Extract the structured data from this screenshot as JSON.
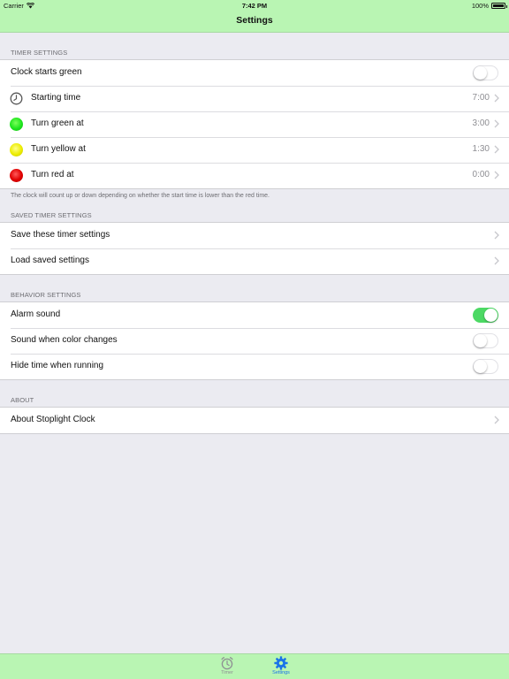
{
  "status_bar": {
    "carrier": "Carrier",
    "time": "7:42 PM",
    "battery": "100%"
  },
  "nav": {
    "title": "Settings"
  },
  "timer_settings": {
    "header": "TIMER SETTINGS",
    "clock_starts_green": {
      "label": "Clock starts green",
      "on": false
    },
    "starting_time": {
      "label": "Starting time",
      "value": "7:00",
      "icon": "clock-icon"
    },
    "turn_green": {
      "label": "Turn green at",
      "value": "3:00",
      "icon": "green-light-icon",
      "color": "#1de51d"
    },
    "turn_yellow": {
      "label": "Turn yellow at",
      "value": "1:30",
      "icon": "yellow-light-icon",
      "color": "#ecec00"
    },
    "turn_red": {
      "label": "Turn red at",
      "value": "0:00",
      "icon": "red-light-icon",
      "color": "#e00000"
    },
    "footer": "The clock will count up or down depending on whether the start time is lower than the red time."
  },
  "saved_timer_settings": {
    "header": "SAVED TIMER SETTINGS",
    "save": {
      "label": "Save these timer settings"
    },
    "load": {
      "label": "Load saved settings"
    }
  },
  "behavior_settings": {
    "header": "BEHAVIOR SETTINGS",
    "alarm_sound": {
      "label": "Alarm sound",
      "on": true
    },
    "sound_color_change": {
      "label": "Sound when color changes",
      "on": false
    },
    "hide_time": {
      "label": "Hide time when running",
      "on": false
    }
  },
  "about": {
    "header": "ABOUT",
    "about_app": {
      "label": "About Stoplight Clock"
    }
  },
  "tab_bar": {
    "timer": {
      "label": "Timer",
      "icon": "alarm-clock-icon",
      "selected": false
    },
    "settings": {
      "label": "Settings",
      "icon": "gear-icon",
      "selected": true
    }
  },
  "colors": {
    "bar_background": "#b9f5b3",
    "toggle_on": "#4cd964",
    "accent": "#1a73e8"
  }
}
